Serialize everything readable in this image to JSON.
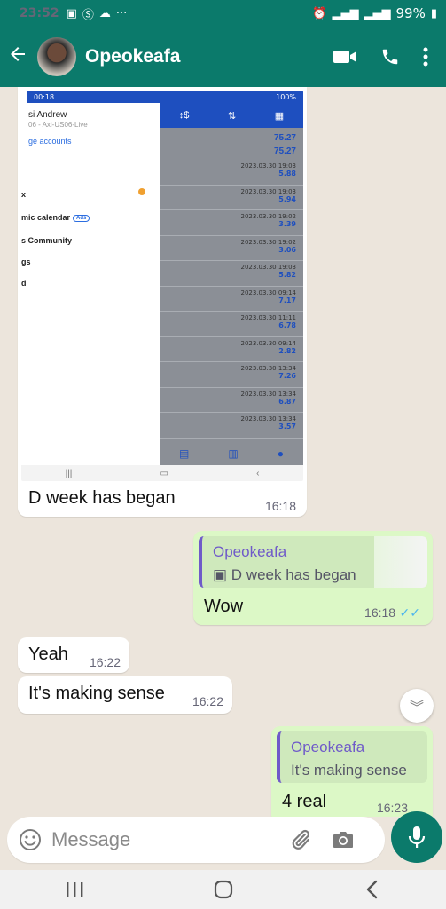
{
  "status_bar": {
    "time": "23:52",
    "battery": "99%"
  },
  "header": {
    "contact_name": "Opeokeafa"
  },
  "image_message": {
    "caption": "D week has began",
    "time": "16:18",
    "embedded_screenshot": {
      "status_time": "00:18",
      "status_battery": "100%",
      "account_name": "si Andrew",
      "account_sub": "06 - Axi-US06-Live",
      "manage_link": "ge accounts",
      "menu_items": [
        "x",
        "mic calendar",
        "s Community",
        "gs",
        "d"
      ],
      "ads_badge": "Ads",
      "top_values": [
        "75.27",
        "75.27"
      ],
      "rows": [
        {
          "date": "2023.03.30 19:03",
          "value": "5.88"
        },
        {
          "date": "2023.03.30 19:03",
          "value": "5.94"
        },
        {
          "date": "2023.03.30 19:02",
          "value": "3.39"
        },
        {
          "date": "2023.03.30 19:02",
          "value": "3.06"
        },
        {
          "date": "2023.03.30 19:03",
          "value": "5.82"
        },
        {
          "date": "2023.03.30 09:14",
          "value": "7.17"
        },
        {
          "date": "2023.03.30 11:11",
          "value": "6.78"
        },
        {
          "date": "2023.03.30 09:14",
          "value": "2.82"
        },
        {
          "date": "2023.03.30 13:34",
          "value": "7.26"
        },
        {
          "date": "2023.03.30 13:34",
          "value": "6.87"
        },
        {
          "date": "2023.03.30 13:34",
          "value": "3.57"
        }
      ]
    }
  },
  "messages": [
    {
      "quote_name": "Opeokeafa",
      "quote_text": "D week has began",
      "text": "Wow",
      "time": "16:18"
    },
    {
      "text": "Yeah",
      "time": "16:22"
    },
    {
      "text": "It's making sense",
      "time": "16:22"
    },
    {
      "quote_name": "Opeokeafa",
      "quote_text": "It's making sense",
      "text": "4 real",
      "time": "16:23"
    }
  ],
  "composer": {
    "placeholder": "Message"
  },
  "colors": {
    "brand": "#0b7a6b",
    "outgoing": "#dcf8c6",
    "quote_accent": "#6f5ac9",
    "read_ticks": "#4fb6ec"
  }
}
